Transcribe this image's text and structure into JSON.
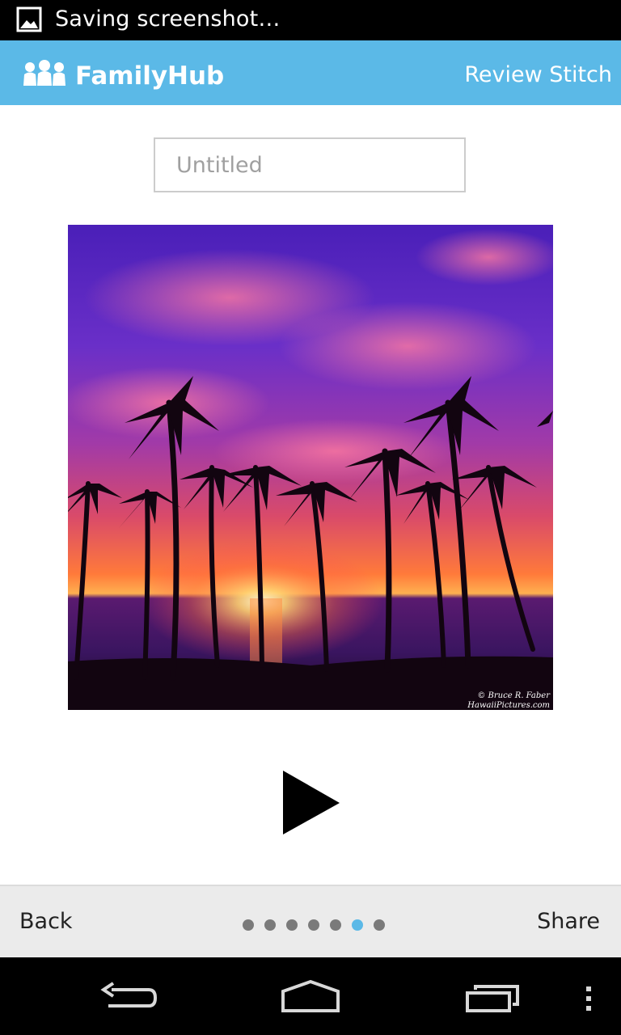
{
  "status_bar": {
    "notification_icon": "image-icon",
    "text": "Saving screenshot…"
  },
  "action_bar": {
    "logo_icon": "family-group-icon",
    "app_title": "FamilyHub",
    "action_label": "Review Stitch",
    "background_color": "#5bb9e7"
  },
  "title_field": {
    "value": "",
    "placeholder": "Untitled"
  },
  "photo": {
    "subject": "palm-trees-sunset-photo",
    "watermark_line1": "© Bruce R. Faber",
    "watermark_line2": "HawaiiPictures.com"
  },
  "player": {
    "icon": "play-icon"
  },
  "bottom_bar": {
    "back_label": "Back",
    "share_label": "Share",
    "page_count": 7,
    "active_page": 6,
    "active_dot_color": "#5bb9e7",
    "inactive_dot_color": "#7a7a7a"
  },
  "nav_bar": {
    "back_icon": "back-arrow-icon",
    "home_icon": "home-icon",
    "recents_icon": "recent-apps-icon",
    "menu_icon": "overflow-menu-icon"
  }
}
